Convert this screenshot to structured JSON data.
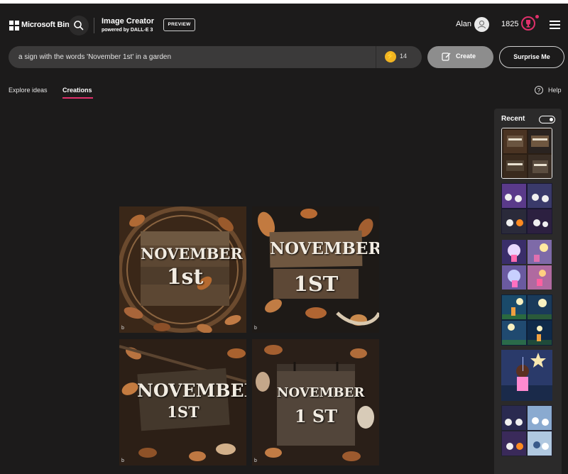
{
  "header": {
    "brand": "Microsoft Bing",
    "title": "Image Creator",
    "subtitle": "powered by DALL-E 3",
    "badge": "PREVIEW",
    "user_name": "Alan",
    "points": "1825"
  },
  "prompt": {
    "value": "a sign with the words 'November 1st' in a garden",
    "boosts": "14",
    "create_label": "Create",
    "surprise_label": "Surprise Me"
  },
  "tabs": [
    {
      "label": "Explore ideas",
      "active": false
    },
    {
      "label": "Creations",
      "active": true
    }
  ],
  "help_label": "Help",
  "images": [
    {
      "line1": "NOVEMBER",
      "line2": "1st"
    },
    {
      "line1": "NOVEMBER",
      "line2": "1ST"
    },
    {
      "line1": "NOVEMBER",
      "line2": "1ST"
    },
    {
      "line1": "NOVEMBER",
      "line2": "1 ST"
    }
  ],
  "image_mark": "b",
  "sidebar": {
    "title": "Recent",
    "toggle_on": true
  },
  "colors": {
    "accent": "#e0306b",
    "background": "#1c1b1b",
    "panel": "#2b2a2a",
    "input": "#3b3a3a",
    "boost": "#f1b422"
  },
  "icons": [
    "search-icon",
    "user-icon",
    "rewards-icon",
    "menu-icon",
    "lightning-icon",
    "create-icon",
    "help-icon"
  ]
}
